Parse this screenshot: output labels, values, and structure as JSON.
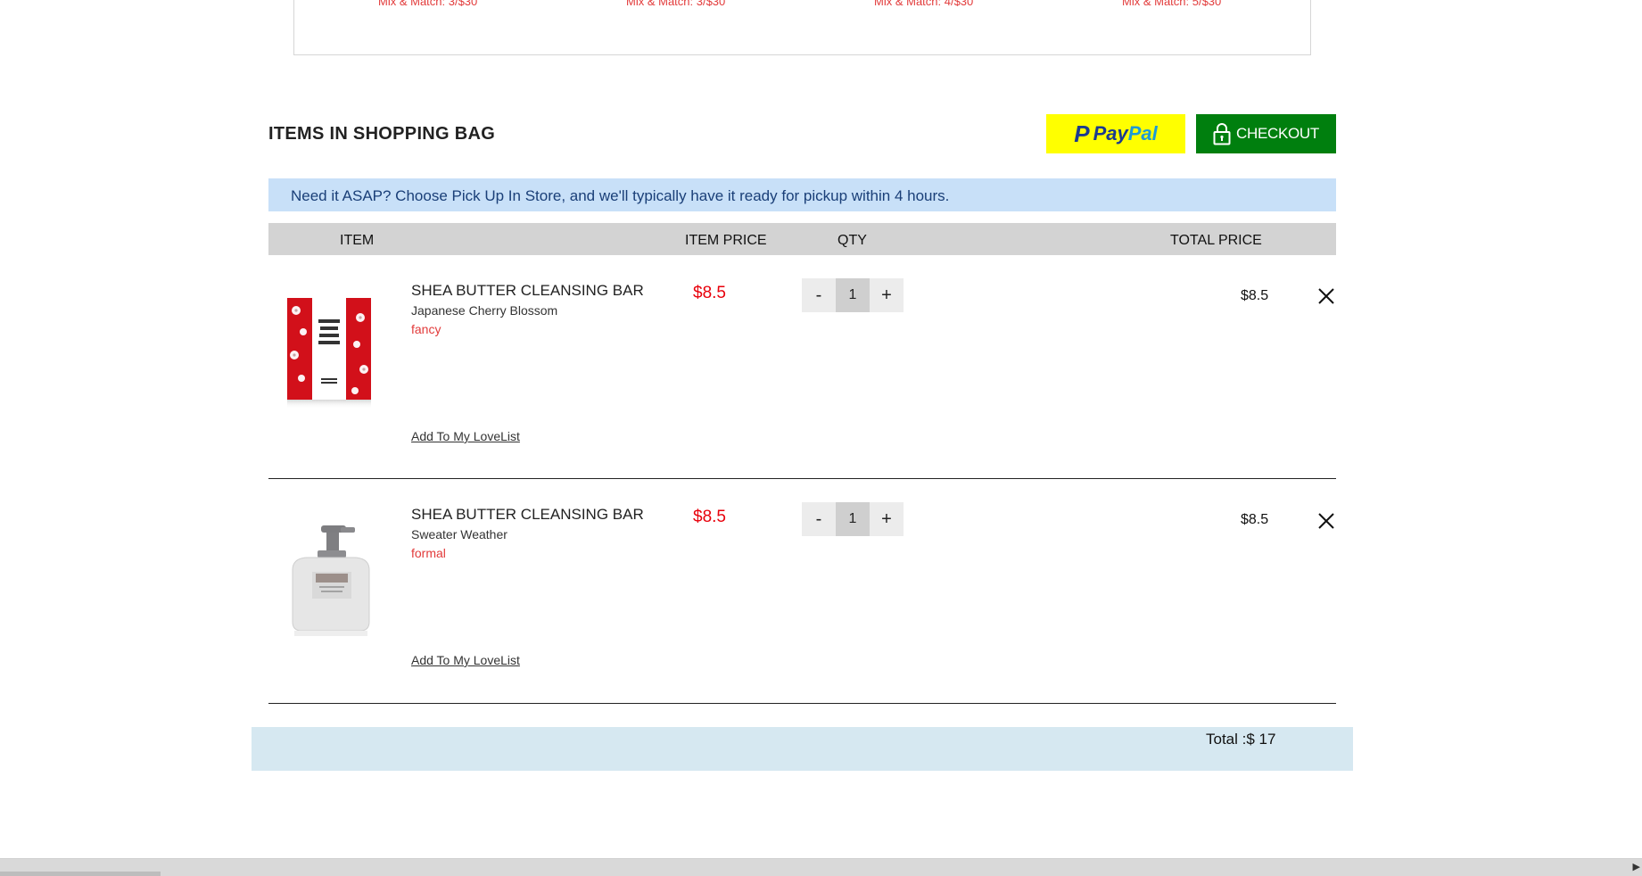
{
  "recommendations": {
    "promos": [
      "Mix & Match: 3/$30",
      "Mix & Match: 3/$30",
      "Mix & Match: 4/$30",
      "Mix & Match: 5/$30"
    ]
  },
  "bag": {
    "title": "ITEMS IN SHOPPING BAG",
    "paypal_label_pay": "Pay",
    "paypal_label_pal": "Pal",
    "paypal_mark": "P",
    "checkout_label": "CHECKOUT"
  },
  "pickup_banner": "Need it ASAP? Choose Pick Up In Store, and we'll typically have it ready for pickup within 4 hours.",
  "table": {
    "headers": {
      "item": "ITEM",
      "item_price": "ITEM PRICE",
      "qty": "QTY",
      "total_price": "TOTAL PRICE"
    }
  },
  "items": [
    {
      "name": "SHEA BUTTER CLEANSING BAR",
      "scent": "Japanese Cherry Blossom",
      "tag": "fancy",
      "price": "$8.5",
      "qty_minus": "-",
      "qty": "1",
      "qty_plus": "+",
      "total": "$8.5",
      "lovelist": "Add To My LoveList"
    },
    {
      "name": "SHEA BUTTER CLEANSING BAR",
      "scent": "Sweater Weather",
      "tag": "formal",
      "price": "$8.5",
      "qty_minus": "-",
      "qty": "1",
      "qty_plus": "+",
      "total": "$8.5",
      "lovelist": "Add To My LoveList"
    }
  ],
  "total": "Total :$ 17",
  "colors": {
    "paypal_bg": "#ffff00",
    "checkout_bg": "#007f0e",
    "price_red": "#e8000b",
    "banner_bg": "#c8e0f8",
    "total_bg": "#d6e8f1"
  }
}
